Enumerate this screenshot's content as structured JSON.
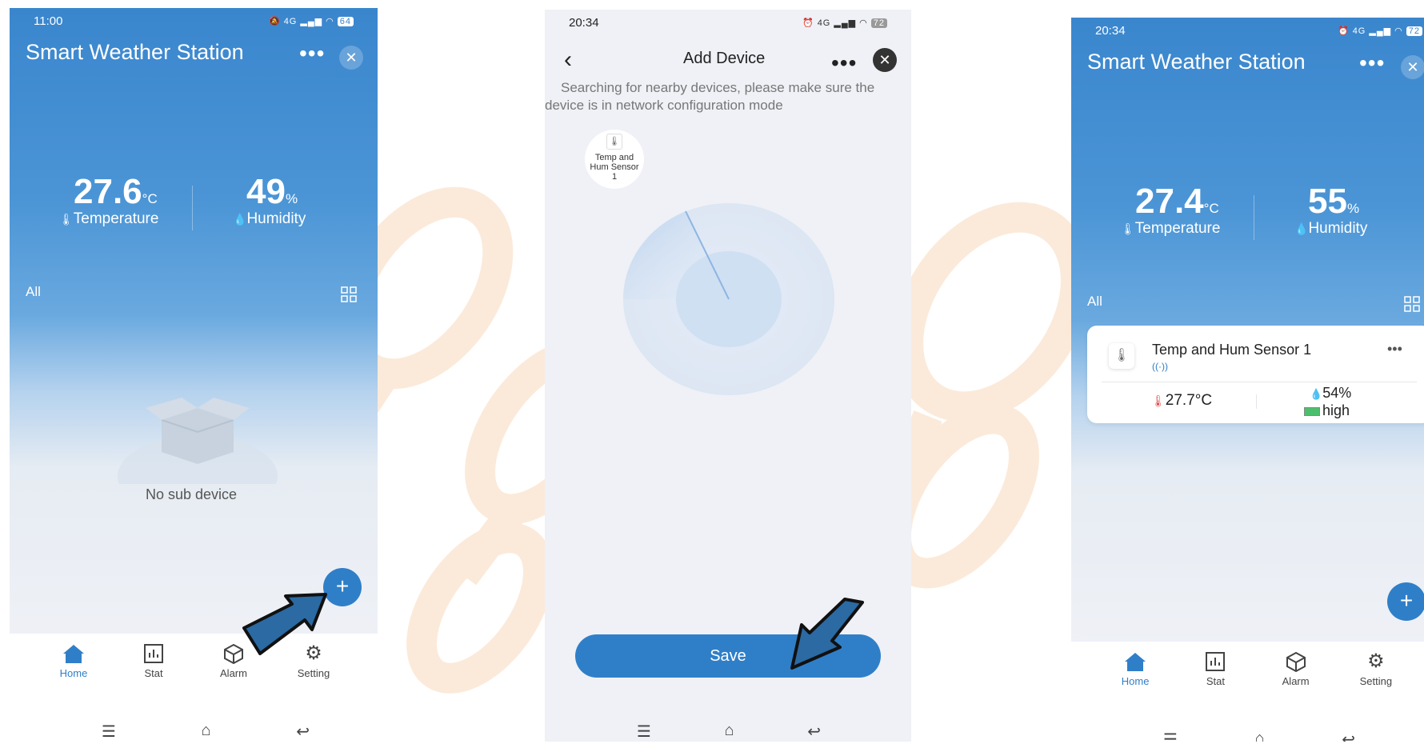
{
  "colors": {
    "accent": "#2f7fc8",
    "sky_top": "#3a86cd",
    "arrow_fill": "#2b6aa3",
    "deco": "#fbe7d4"
  },
  "phone1": {
    "time": "11:00",
    "battery": "64",
    "title": "Smart Weather Station",
    "temperature": {
      "value": "27.6",
      "unit": "°C",
      "label": "Temperature"
    },
    "humidity": {
      "value": "49",
      "unit": "%",
      "label": "Humidity"
    },
    "filter_label": "All",
    "empty_text": "No sub device",
    "nav": [
      "Home",
      "Stat",
      "Alarm",
      "Setting"
    ]
  },
  "phone2": {
    "time": "20:34",
    "battery": "72",
    "title": "Add Device",
    "hint": "Searching for nearby devices, please make sure the device is in network configuration mode",
    "found_device": "Temp and Hum Sensor 1",
    "save_label": "Save"
  },
  "phone3": {
    "time": "20:34",
    "battery": "72",
    "title": "Smart Weather Station",
    "temperature": {
      "value": "27.4",
      "unit": "°C",
      "label": "Temperature"
    },
    "humidity": {
      "value": "55",
      "unit": "%",
      "label": "Humidity"
    },
    "filter_label": "All",
    "device": {
      "name": "Temp and Hum Sensor 1",
      "temp": "27.7°C",
      "humidity": "54%",
      "battery": "high"
    },
    "nav": [
      "Home",
      "Stat",
      "Alarm",
      "Setting"
    ]
  }
}
